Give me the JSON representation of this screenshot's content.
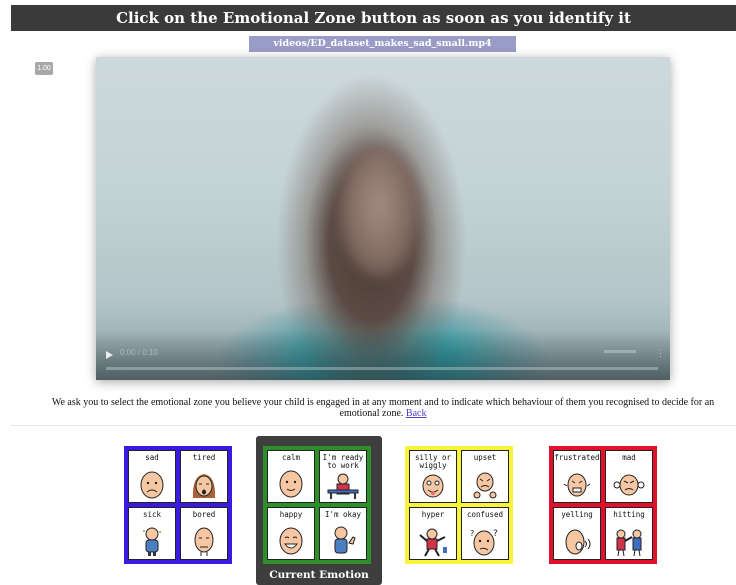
{
  "header": {
    "title": "Click on the Emotional Zone button as soon as you identify it"
  },
  "video": {
    "filename": "videos/ED_dataset_makes_sad_small.mp4",
    "speed": "1.00",
    "time": "0:00 / 0:10"
  },
  "instructions": {
    "text": "We ask you to select the emotional zone you believe your child is engaged in at any moment and to indicate which behaviour of them you recognised to decide for an emotional zone.",
    "back_link": "Back"
  },
  "zones": {
    "blue": {
      "color": "#3a19e0",
      "cards": [
        "sad",
        "tired",
        "sick",
        "bored"
      ]
    },
    "green": {
      "color": "#2e8e2a",
      "cards": [
        "calm",
        "I'm ready to work",
        "happy",
        "I'm okay"
      ],
      "selected": true
    },
    "yellow": {
      "color": "#f8f43a",
      "cards": [
        "silly or wiggly",
        "upset",
        "hyper",
        "confused"
      ]
    },
    "red": {
      "color": "#e3102b",
      "cards": [
        "frustrated",
        "mad",
        "yelling",
        "hitting"
      ]
    }
  },
  "current_emotion_label": "Current Emotion"
}
